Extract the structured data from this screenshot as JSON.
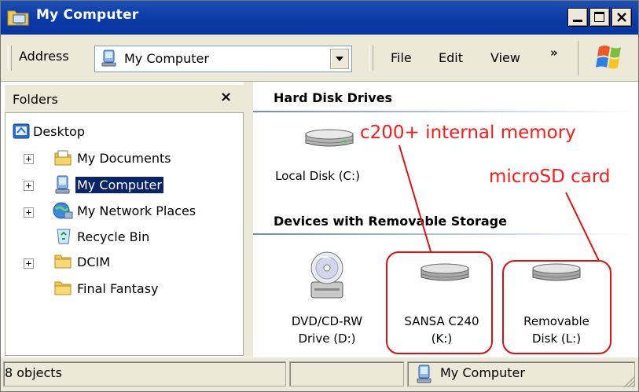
{
  "window": {
    "title": "My Computer",
    "title_icon": "my-computer-folder-icon",
    "buttons": [
      "minimize-icon",
      "maximize-icon",
      "close-icon"
    ]
  },
  "toolbar": {
    "address_label": "Address",
    "address_value": "My Computer",
    "menus": [
      "File",
      "Edit",
      "View"
    ],
    "overflow": "»"
  },
  "folders": {
    "title": "Folders",
    "close": "×",
    "items": [
      {
        "label": "Desktop",
        "icon": "desktop-icon",
        "expander": ""
      },
      {
        "label": "My Documents",
        "icon": "my-documents-icon",
        "expander": "+"
      },
      {
        "label": "My Computer",
        "icon": "my-computer-icon",
        "expander": "+",
        "selected": true
      },
      {
        "label": "My Network Places",
        "icon": "network-places-icon",
        "expander": "+"
      },
      {
        "label": "Recycle Bin",
        "icon": "recycle-bin-icon",
        "expander": ""
      },
      {
        "label": "DCIM",
        "icon": "folder-icon",
        "expander": "+"
      },
      {
        "label": "Final Fantasy",
        "icon": "folder-icon",
        "expander": ""
      }
    ]
  },
  "content": {
    "groups": [
      {
        "heading": "Hard Disk Drives"
      },
      {
        "heading": "Devices with Removable Storage"
      }
    ],
    "drives": [
      {
        "line1": "Local Disk (C:)",
        "line2": "",
        "icon": "hard-disk-icon"
      },
      {
        "line1": "DVD/CD-RW",
        "line2": "Drive (D:)",
        "icon": "dvd-drive-icon"
      },
      {
        "line1": "SANSA C240",
        "line2": "(K:)",
        "icon": "removable-disk-icon"
      },
      {
        "line1": "Removable",
        "line2": "Disk (L:)",
        "icon": "removable-disk-icon"
      }
    ],
    "annotations": {
      "internal": "c200+ internal memory",
      "microsd": "microSD card"
    }
  },
  "status": {
    "objects": "8 objects",
    "location": "My Computer"
  },
  "colors": {
    "titlebar": "#0a3aa6",
    "chrome": "#ece9d8",
    "selection": "#0a246a",
    "annotation": "#ff1a1a"
  }
}
